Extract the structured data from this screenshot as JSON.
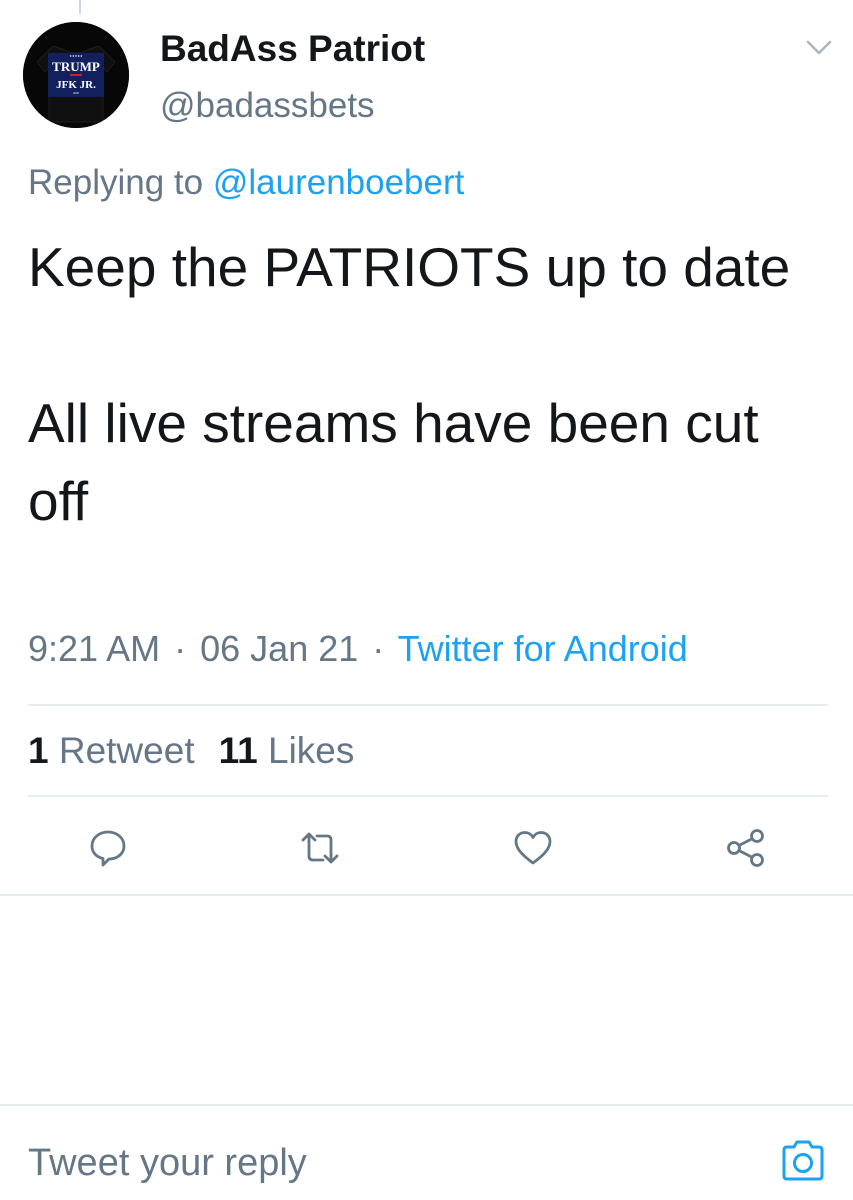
{
  "author": {
    "display_name": "BadAss Patriot",
    "handle": "@badassbets",
    "avatar_shirt_text": [
      "TRUMP",
      "JFK JR."
    ]
  },
  "reply_context": {
    "prefix": "Replying to",
    "mention": "@laurenboebert"
  },
  "tweet": {
    "paragraph_1": "Keep the PATRIOTS up to date",
    "paragraph_2": "All live streams have been cut off"
  },
  "meta": {
    "time": "9:21 AM",
    "date": "06 Jan 21",
    "separator": "·",
    "source": "Twitter for Android"
  },
  "stats": {
    "retweets_count": "1",
    "retweets_label": "Retweet",
    "likes_count": "11",
    "likes_label": "Likes"
  },
  "actions": [
    "reply-icon",
    "retweet-icon",
    "like-icon",
    "share-icon"
  ],
  "composer": {
    "placeholder": "Tweet your reply",
    "camera_icon": "camera-icon"
  },
  "colors": {
    "primary_text": "#14171a",
    "secondary_text": "#657786",
    "accent": "#1da1f2",
    "divider": "#e6ecf0"
  }
}
